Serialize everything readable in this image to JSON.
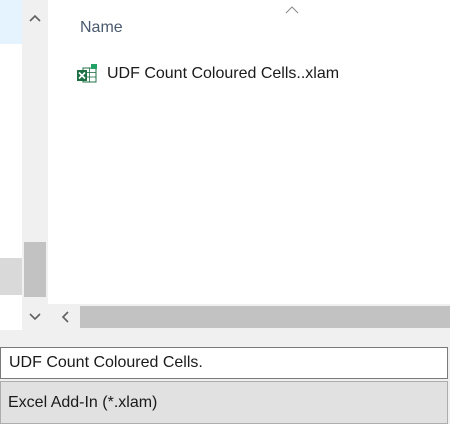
{
  "file_list": {
    "column_header": "Name",
    "sort_direction": "ascending",
    "items": [
      {
        "name": "UDF Count Coloured Cells..xlam",
        "icon": "excel-addin-icon"
      }
    ]
  },
  "save_fields": {
    "file_name_value": "UDF Count Coloured Cells.",
    "file_type_value": "Excel Add-In (*.xlam)"
  },
  "colors": {
    "excel_green": "#1d7044",
    "addin_accent": "#21a366",
    "scrollbar_thumb": "#c2c2c2",
    "nav_selected": "#e5f3ff"
  }
}
